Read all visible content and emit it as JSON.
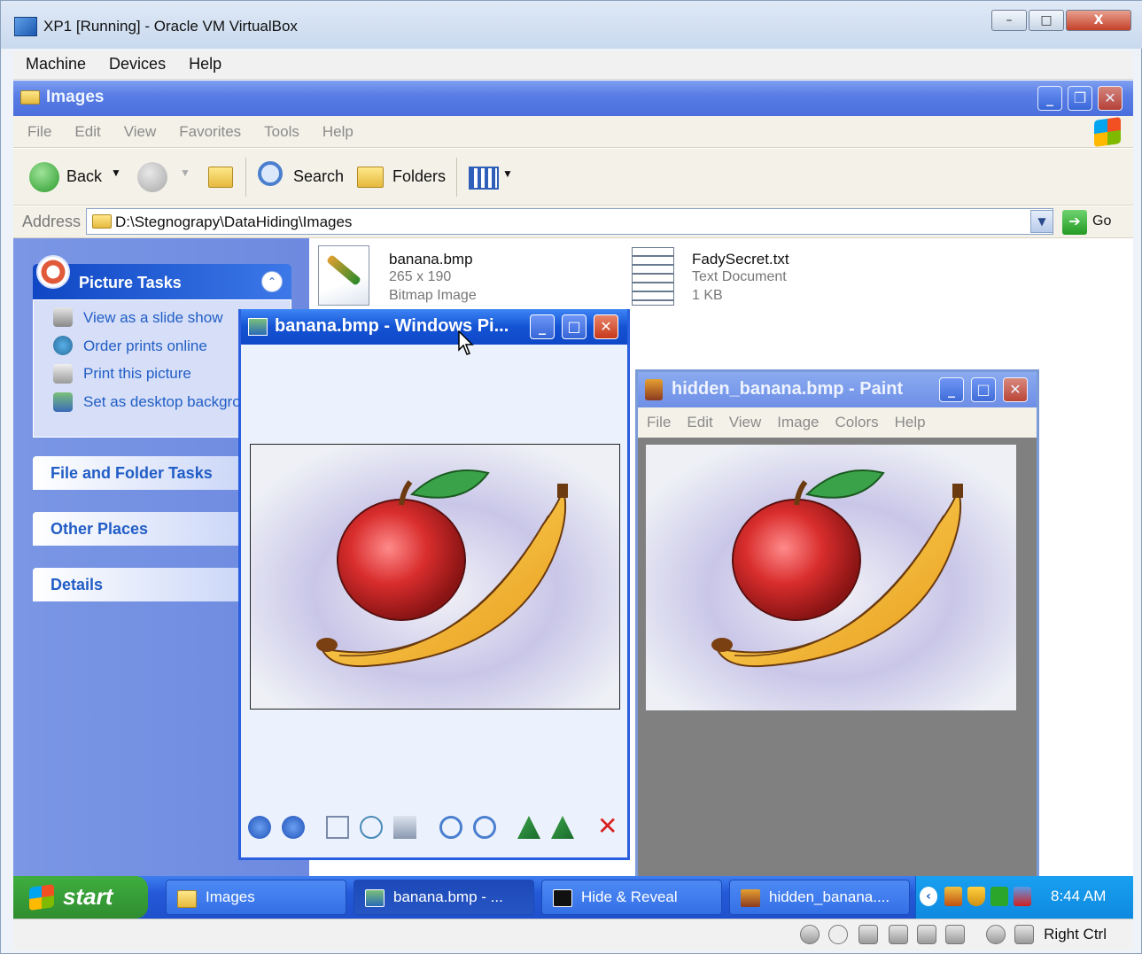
{
  "host": {
    "title": "XP1 [Running] - Oracle VM VirtualBox",
    "menu": [
      "Machine",
      "Devices",
      "Help"
    ],
    "status_right": "Right Ctrl"
  },
  "explorer": {
    "title": "Images",
    "menu": [
      "File",
      "Edit",
      "View",
      "Favorites",
      "Tools",
      "Help"
    ],
    "toolbar": {
      "back": "Back",
      "search": "Search",
      "folders": "Folders"
    },
    "address_label": "Address",
    "address_value": "D:\\Stegnograpy\\DataHiding\\Images",
    "go": "Go",
    "tasks": {
      "picture_tasks": "Picture Tasks",
      "items": [
        "View as a slide show",
        "Order prints online",
        "Print this picture",
        "Set as desktop background"
      ],
      "file_folder_tasks": "File and Folder Tasks",
      "other_places": "Other Places",
      "details": "Details"
    },
    "files": [
      {
        "name": "banana.bmp",
        "line2": "265 x 190",
        "line3": "Bitmap Image"
      },
      {
        "name": "FadySecret.txt",
        "line2": "Text Document",
        "line3": "1 KB"
      }
    ]
  },
  "viewer": {
    "title": "banana.bmp - Windows Pi..."
  },
  "paint": {
    "title": "hidden_banana.bmp - Paint",
    "menu": [
      "File",
      "Edit",
      "View",
      "Image",
      "Colors",
      "Help"
    ]
  },
  "taskbar": {
    "start": "start",
    "tasks": [
      "Images",
      "banana.bmp - ...",
      "Hide & Reveal",
      "hidden_banana...."
    ],
    "clock": "8:44 AM"
  }
}
